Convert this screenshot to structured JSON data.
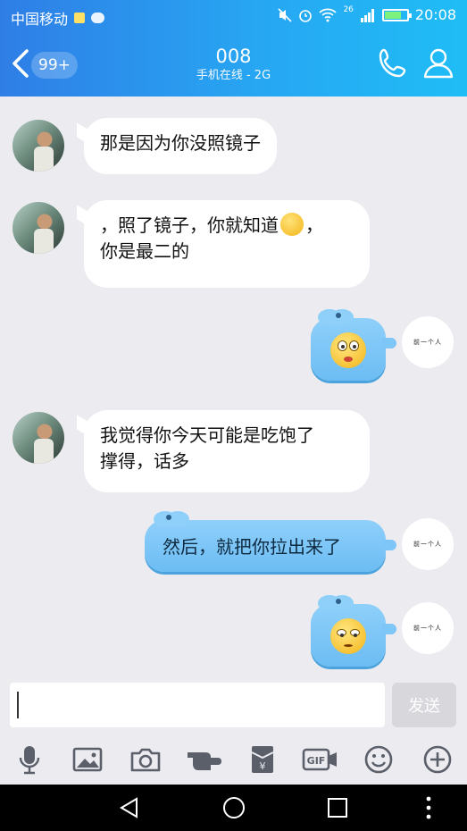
{
  "status_bar": {
    "carrier": "中国移动",
    "network": "26",
    "time": "20:08",
    "battery_level": 0.75
  },
  "header": {
    "unread_badge": "99+",
    "title": "008",
    "subtitle": "手机在线 - 2G"
  },
  "messages": [
    {
      "side": "left",
      "text": "那是因为你没照镜子"
    },
    {
      "side": "left",
      "text_line1_a": "，照了镜子，你就知道",
      "text_line1_b": "，",
      "text_line2": "你是最二的",
      "emoji": "smile"
    },
    {
      "side": "right",
      "kind": "sticker"
    },
    {
      "side": "left",
      "text_line1": "我觉得你今天可能是吃饱了",
      "text_line2": "撑得，话多"
    },
    {
      "side": "right",
      "text": "然后，就把你拉出来了"
    },
    {
      "side": "right",
      "kind": "sticker"
    }
  ],
  "self_avatar_text": "前一个人",
  "input": {
    "value": "",
    "send_label": "发送"
  },
  "toolbar_icons": [
    "mic-icon",
    "image-icon",
    "camera-icon",
    "poke-icon",
    "red-packet-icon",
    "gif-icon",
    "emoji-icon",
    "plus-icon"
  ],
  "navbar_icons": [
    "back-triangle-icon",
    "home-circle-icon",
    "recents-square-icon",
    "more-dots-icon"
  ],
  "colors": {
    "header_start": "#2f7ee6",
    "header_end": "#1fbdf6",
    "chat_bg": "#ebebf0"
  }
}
